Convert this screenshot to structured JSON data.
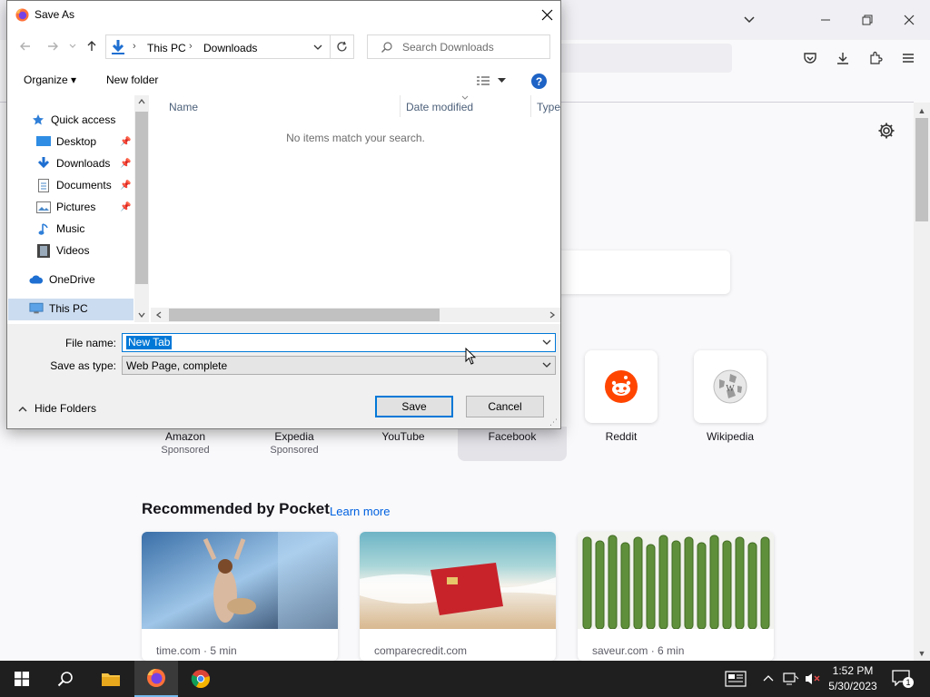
{
  "browser": {
    "new_tab_sites": [
      {
        "name": "Amazon",
        "sub": "Sponsored"
      },
      {
        "name": "Expedia",
        "sub": "Sponsored"
      },
      {
        "name": "YouTube",
        "sub": ""
      },
      {
        "name": "Facebook",
        "sub": ""
      },
      {
        "name": "Reddit",
        "sub": ""
      },
      {
        "name": "Wikipedia",
        "sub": ""
      }
    ],
    "pocket": {
      "heading": "Recommended by Pocket",
      "learn_more": "Learn more",
      "cards": [
        {
          "source": "time.com · 5 min"
        },
        {
          "source": "comparecredit.com"
        },
        {
          "source": "saveur.com · 6 min"
        }
      ]
    }
  },
  "dialog": {
    "title": "Save As",
    "address": {
      "root": "This PC",
      "folder": "Downloads"
    },
    "search_placeholder": "Search Downloads",
    "toolbar": {
      "organize": "Organize",
      "new_folder": "New folder"
    },
    "nav_pane": {
      "quick_access": "Quick access",
      "items": [
        "Desktop",
        "Downloads",
        "Documents",
        "Pictures",
        "Music",
        "Videos"
      ],
      "onedrive": "OneDrive",
      "this_pc": "This PC"
    },
    "columns": {
      "name": "Name",
      "date_modified": "Date modified",
      "type": "Type"
    },
    "empty_message": "No items match your search.",
    "file_name_label": "File name:",
    "file_name_value": "New Tab",
    "save_as_type_label": "Save as type:",
    "save_as_type_value": "Web Page, complete",
    "hide_folders": "Hide Folders",
    "save_label": "Save",
    "cancel_label": "Cancel"
  },
  "taskbar": {
    "time": "1:52 PM",
    "date": "5/30/2023",
    "notification_count": "1"
  },
  "colors": {
    "accent": "#0078d7",
    "firefox_link": "#0061e0",
    "reddit": "#ff4500",
    "taskbar": "#1f1f1f"
  }
}
